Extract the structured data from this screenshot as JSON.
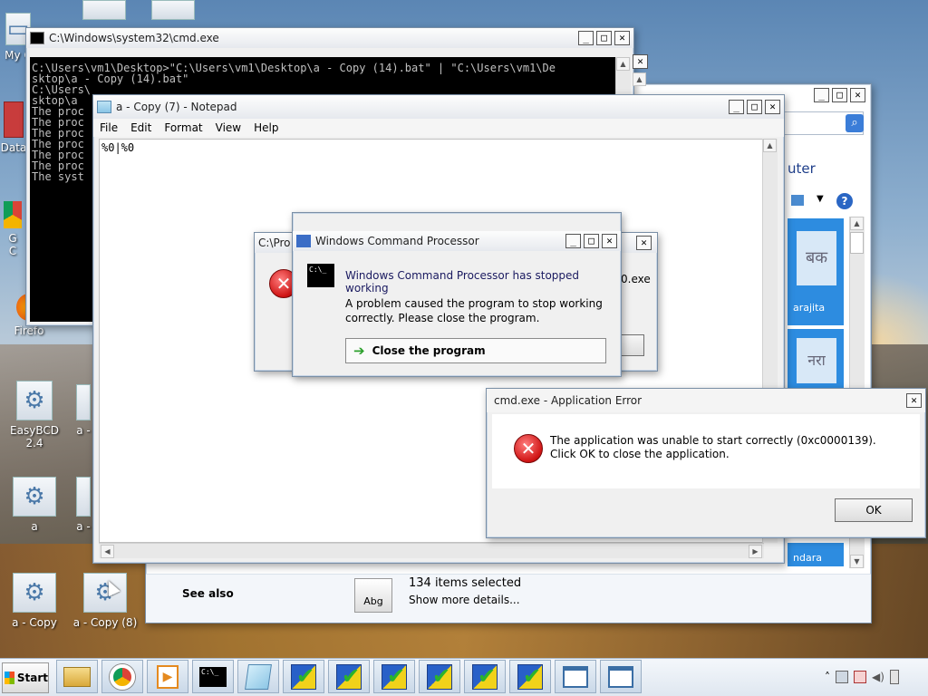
{
  "desktop": {
    "icons": [
      {
        "label": "My C"
      },
      {
        "label": "Data"
      },
      {
        "label": "G"
      },
      {
        "label": "C"
      },
      {
        "label": "Firefo"
      },
      {
        "label": "EasyBCD 2.4"
      },
      {
        "label": "a -"
      },
      {
        "label": "a"
      },
      {
        "label": "a -"
      },
      {
        "label": "a - Copy"
      },
      {
        "label": "a - Copy (8)"
      }
    ]
  },
  "cmd_window": {
    "title": "C:\\Windows\\system32\\cmd.exe",
    "lines": [
      "C:\\Users\\vm1\\Desktop>\"C:\\Users\\vm1\\Desktop\\a - Copy (14).bat\" | \"C:\\Users\\vm1\\De",
      "sktop\\a - Copy (14).bat\"",
      "",
      "C:\\Users\\",
      "sktop\\a",
      "The proc",
      "The proc",
      "The proc",
      "The proc",
      "The proc",
      "The proc",
      "The syst"
    ]
  },
  "notepad": {
    "title": "a - Copy (7) - Notepad",
    "menu": [
      "File",
      "Edit",
      "Format",
      "View",
      "Help"
    ],
    "content": "%0|%0"
  },
  "behind_dialog": {
    "title": "C:\\Pro",
    "partial_text": "0.exe"
  },
  "wcp_dialog": {
    "title": "Windows Command Processor",
    "heading": "Windows Command Processor has stopped working",
    "message": "A problem caused the program to stop working correctly. Please close the program.",
    "close_button": "Close the program"
  },
  "app_error": {
    "title": "cmd.exe - Application Error",
    "message": "The application was unable to start correctly (0xc0000139). Click OK to close the application.",
    "ok_button": "OK"
  },
  "explorer": {
    "heading_fragment": "uter",
    "tile_labels": [
      "arajita",
      "ndara"
    ],
    "tile_script": [
      "बक",
      "नरा"
    ],
    "see_also": "See also",
    "selection_count": "134 items selected",
    "details_link": "Show more details...",
    "thumb_label": "Abg"
  },
  "taskbar": {
    "start_label": "Start",
    "items": [
      "explorer",
      "chrome",
      "media-player",
      "cmd",
      "notepad",
      "easybcd-1",
      "easybcd-2",
      "easybcd-3",
      "easybcd-4",
      "easybcd-5",
      "easybcd-6",
      "window-1",
      "window-2"
    ]
  },
  "colors": {
    "accent": "#2860c8",
    "error_red": "#d01414",
    "titlebar": "#e6e9ee"
  }
}
